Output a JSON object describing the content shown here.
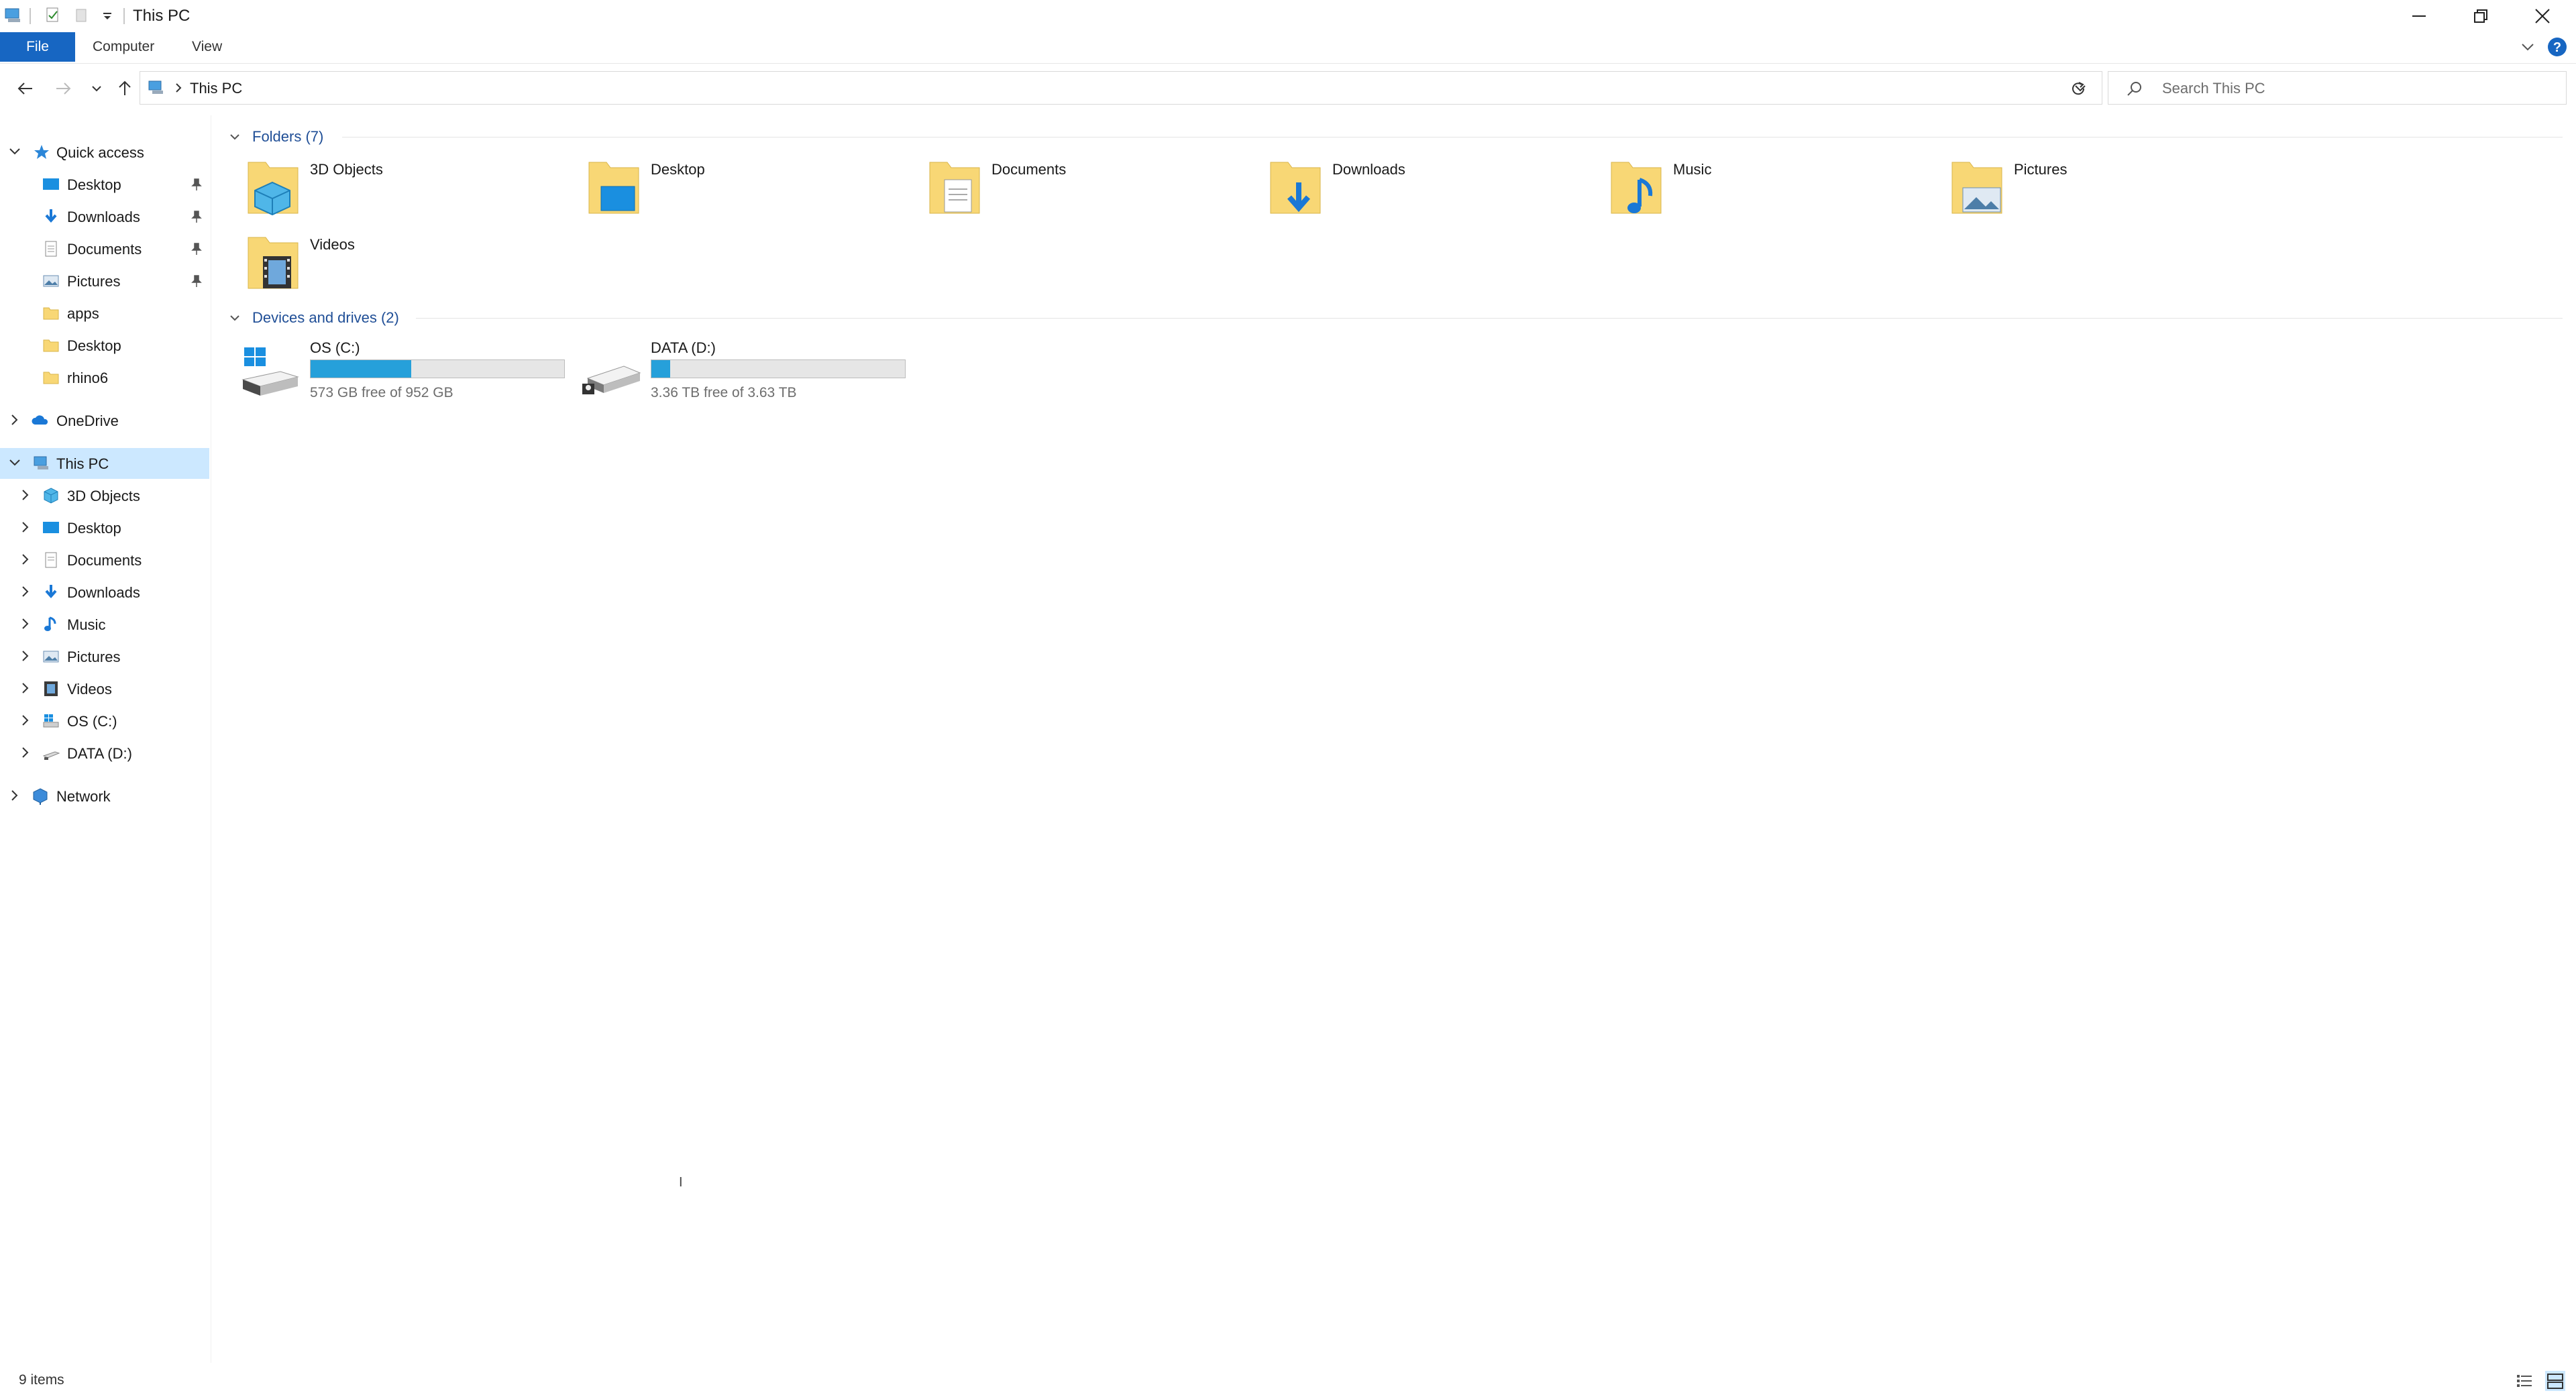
{
  "window": {
    "title": "This PC"
  },
  "ribbon": {
    "tabs": [
      "File",
      "Computer",
      "View"
    ]
  },
  "address": {
    "path": "This PC"
  },
  "search": {
    "placeholder": "Search This PC"
  },
  "nav": {
    "quick_access": "Quick access",
    "quick_items": [
      {
        "label": "Desktop",
        "pinned": true
      },
      {
        "label": "Downloads",
        "pinned": true
      },
      {
        "label": "Documents",
        "pinned": true
      },
      {
        "label": "Pictures",
        "pinned": true
      },
      {
        "label": "apps",
        "pinned": false
      },
      {
        "label": "Desktop",
        "pinned": false
      },
      {
        "label": "rhino6",
        "pinned": false
      }
    ],
    "onedrive": "OneDrive",
    "this_pc": "This PC",
    "pc_items": [
      "3D Objects",
      "Desktop",
      "Documents",
      "Downloads",
      "Music",
      "Pictures",
      "Videos",
      "OS (C:)",
      "DATA (D:)"
    ],
    "network": "Network"
  },
  "content": {
    "folders_header": "Folders (7)",
    "folders": [
      "3D Objects",
      "Desktop",
      "Documents",
      "Downloads",
      "Music",
      "Pictures",
      "Videos"
    ],
    "drives_header": "Devices and drives (2)",
    "drives": [
      {
        "name": "OS (C:)",
        "info": "573 GB free of 952 GB",
        "used_fraction": 0.398
      },
      {
        "name": "DATA (D:)",
        "info": "3.36 TB free of 3.63 TB",
        "used_fraction": 0.074
      }
    ]
  },
  "status": {
    "items": "9 items"
  },
  "colors": {
    "accent": "#1766c2",
    "selection": "#cce8ff",
    "drive_bar": "#26a0da",
    "folder": "#f8d775"
  }
}
